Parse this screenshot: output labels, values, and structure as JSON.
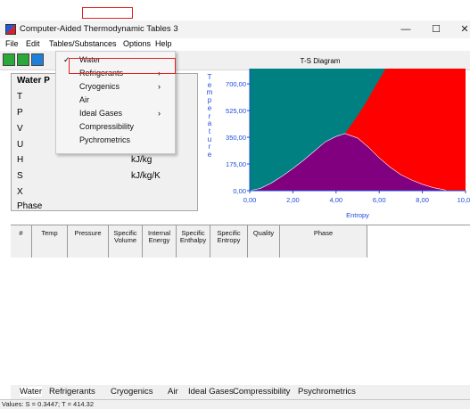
{
  "window": {
    "title": "Computer-Aided Thermodynamic Tables 3",
    "minimize": "—",
    "maximize": "☐",
    "close": "✕"
  },
  "menu": [
    "File",
    "Edit",
    "Tables/Substances",
    "Options",
    "Help"
  ],
  "dropdown": {
    "items": [
      {
        "label": "Water",
        "checked": true,
        "submenu": false
      },
      {
        "label": "Refrigerants",
        "checked": false,
        "submenu": true
      },
      {
        "label": "Cryogenics",
        "checked": false,
        "submenu": true
      },
      {
        "label": "Air",
        "checked": false,
        "submenu": false
      },
      {
        "label": "Ideal Gases",
        "checked": false,
        "submenu": true
      },
      {
        "label": "Compressibility",
        "checked": false,
        "submenu": false
      },
      {
        "label": "Pychrometrics",
        "checked": false,
        "submenu": false
      }
    ],
    "check_glyph": "✓",
    "arrow_glyph": "›"
  },
  "properties": {
    "title": "Water P",
    "rows": [
      {
        "symbol": "T",
        "unit": ""
      },
      {
        "symbol": "P",
        "unit": ""
      },
      {
        "symbol": "V",
        "unit": ""
      },
      {
        "symbol": "U",
        "unit": ""
      },
      {
        "symbol": "H",
        "unit": "kJ/kg"
      },
      {
        "symbol": "S",
        "unit": "kJ/kg/K"
      },
      {
        "symbol": "X",
        "unit": ""
      },
      {
        "symbol": "Phase",
        "unit": ""
      }
    ]
  },
  "chart_data": {
    "type": "area",
    "title": "T-S Diagram",
    "xlabel": "Entropy",
    "ylabel": "Temperature",
    "xlim": [
      0,
      10
    ],
    "ylim": [
      0,
      800
    ],
    "xticks": [
      "0,00",
      "2,00",
      "4,00",
      "6,00",
      "8,00",
      "10,00"
    ],
    "yticks": [
      "0,00",
      "175,00",
      "350,00",
      "525,00",
      "700,00"
    ],
    "regions": [
      {
        "name": "liquid",
        "color": "#008080"
      },
      {
        "name": "two-phase",
        "color": "#800080"
      },
      {
        "name": "vapor",
        "color": "#ff0000"
      }
    ],
    "dome": {
      "s": [
        0.0,
        0.5,
        1.0,
        1.5,
        2.0,
        2.5,
        3.0,
        3.5,
        4.0,
        4.41,
        5.0,
        5.5,
        6.0,
        6.5,
        7.0,
        7.5,
        8.0,
        8.5,
        9.0,
        9.15
      ],
      "t": [
        0,
        15,
        50,
        95,
        145,
        200,
        260,
        320,
        355,
        374,
        345,
        285,
        215,
        155,
        105,
        70,
        42,
        20,
        6,
        0
      ]
    },
    "boundary": {
      "s": [
        4.41,
        4.9,
        5.4,
        5.8,
        6.3
      ],
      "t": [
        374,
        470,
        580,
        680,
        800
      ]
    }
  },
  "grid": {
    "columns": [
      "#",
      "Temp",
      "Pressure",
      "Specific\nVolume",
      "Internal\nEnergy",
      "Specific\nEnthalpy",
      "Specific\nEntropy",
      "Quality",
      "Phase"
    ]
  },
  "tabs": [
    "Water",
    "Refrigerants",
    "Cryogenics",
    "Air",
    "Ideal Gases",
    "Compressibility",
    "Psychrometrics"
  ],
  "status": "Values: S = 0.3447; T = 414.32"
}
